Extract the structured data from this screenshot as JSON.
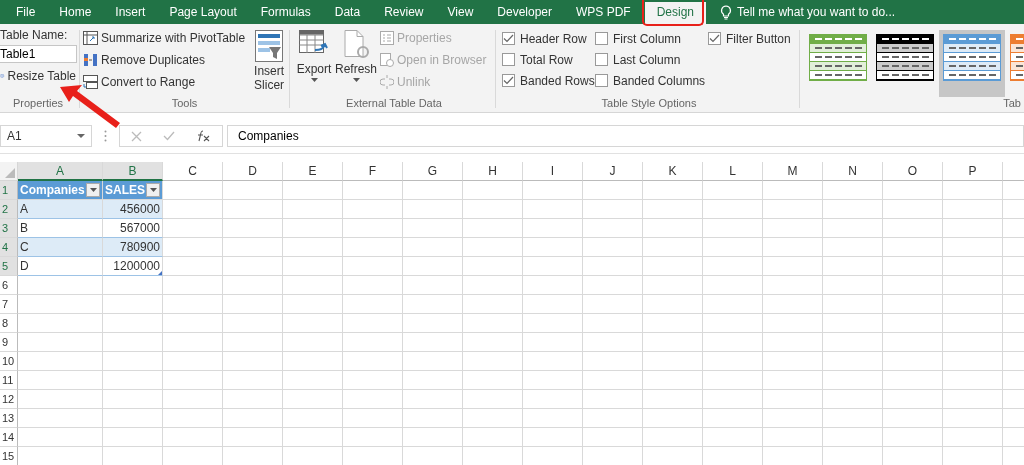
{
  "menu_tabs": [
    {
      "label": "File",
      "selected": false
    },
    {
      "label": "Home",
      "selected": false
    },
    {
      "label": "Insert",
      "selected": false
    },
    {
      "label": "Page Layout",
      "selected": false
    },
    {
      "label": "Formulas",
      "selected": false
    },
    {
      "label": "Data",
      "selected": false
    },
    {
      "label": "Review",
      "selected": false
    },
    {
      "label": "View",
      "selected": false
    },
    {
      "label": "Developer",
      "selected": false
    },
    {
      "label": "WPS PDF",
      "selected": false
    },
    {
      "label": "Design",
      "selected": true
    }
  ],
  "tell_me": {
    "placeholder": "Tell me what you want to do..."
  },
  "properties_group": {
    "label": "Properties",
    "name_label": "Table Name:",
    "name_value": "Table1",
    "resize": "Resize Table"
  },
  "tools_group": {
    "label": "Tools",
    "items": [
      {
        "label": "Summarize with PivotTable",
        "disabled": false
      },
      {
        "label": "Remove Duplicates",
        "disabled": false
      },
      {
        "label": "Convert to Range",
        "disabled": false
      }
    ],
    "slicer": "Insert Slicer"
  },
  "external_group": {
    "label": "External Table Data",
    "big": [
      {
        "label": "Export",
        "disabled": false
      },
      {
        "label": "Refresh",
        "disabled": false
      }
    ],
    "items": [
      {
        "label": "Properties",
        "disabled": true
      },
      {
        "label": "Open in Browser",
        "disabled": true
      },
      {
        "label": "Unlink",
        "disabled": true
      }
    ]
  },
  "style_options": {
    "label": "Table Style Options",
    "options": [
      {
        "label": "Header Row",
        "checked": true
      },
      {
        "label": "Total Row",
        "checked": false
      },
      {
        "label": "Banded Rows",
        "checked": true
      },
      {
        "label": "First Column",
        "checked": false
      },
      {
        "label": "Last Column",
        "checked": false
      },
      {
        "label": "Banded Columns",
        "checked": false
      },
      {
        "label": "Filter Button",
        "checked": true
      }
    ]
  },
  "table_styles": {
    "label": "Tab",
    "styles": [
      {
        "color": "#70ad47",
        "selected": false
      },
      {
        "color": "#000000",
        "selected": false
      },
      {
        "color": "#5b9bd5",
        "selected": true
      },
      {
        "color": "#ed7d31",
        "selected": false
      }
    ]
  },
  "formula_bar": {
    "name_box": "A1",
    "formula": "Companies"
  },
  "sheet": {
    "columns": [
      "A",
      "B",
      "C",
      "D",
      "E",
      "F",
      "G",
      "H",
      "I",
      "J",
      "K",
      "L",
      "M",
      "N",
      "O",
      "P"
    ],
    "rows": [
      "1",
      "2",
      "3",
      "4",
      "5",
      "6",
      "7",
      "8",
      "9",
      "10",
      "11",
      "12",
      "13",
      "14",
      "15"
    ],
    "table_header": [
      "Companies",
      "SALES"
    ],
    "table_rows": [
      [
        "A",
        "456000"
      ],
      [
        "B",
        "567000"
      ],
      [
        "C",
        "780900"
      ],
      [
        "D",
        "1200000"
      ]
    ]
  }
}
